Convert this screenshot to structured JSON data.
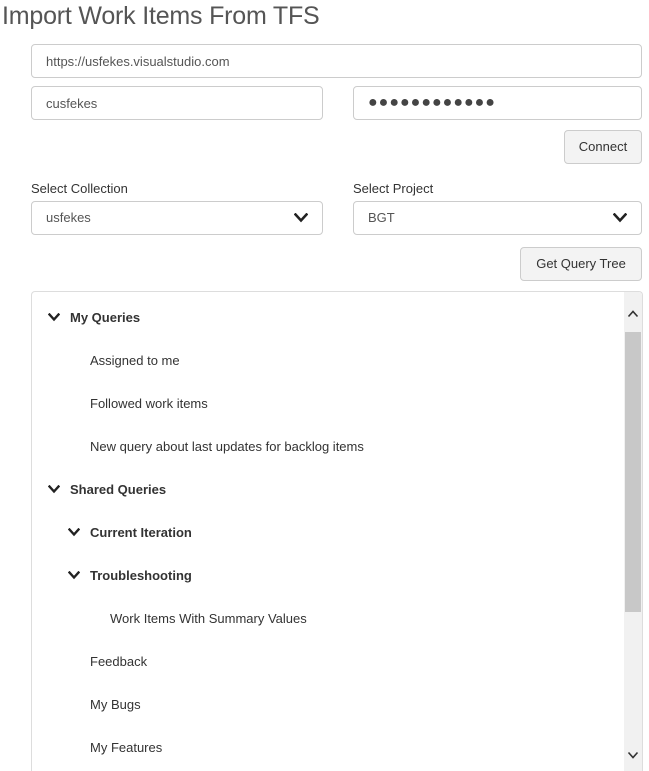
{
  "page": {
    "title": "Import Work Items From TFS"
  },
  "connection": {
    "url_value": "https://usfekes.visualstudio.com",
    "username_value": "cusfekes",
    "password_mask": "●●●●●●●●●●●●",
    "connect_label": "Connect"
  },
  "selectors": {
    "collection_label": "Select Collection",
    "collection_value": "usfekes",
    "project_label": "Select Project",
    "project_value": "BGT",
    "get_query_tree_label": "Get Query Tree"
  },
  "tree": {
    "items": [
      {
        "label": "My Queries"
      },
      {
        "label": "Assigned to me"
      },
      {
        "label": "Followed work items"
      },
      {
        "label": "New query about last updates for backlog items"
      },
      {
        "label": "Shared Queries"
      },
      {
        "label": "Current Iteration"
      },
      {
        "label": "Troubleshooting"
      },
      {
        "label": "Work Items With Summary Values"
      },
      {
        "label": "Feedback"
      },
      {
        "label": "My Bugs"
      },
      {
        "label": "My Features"
      }
    ]
  }
}
